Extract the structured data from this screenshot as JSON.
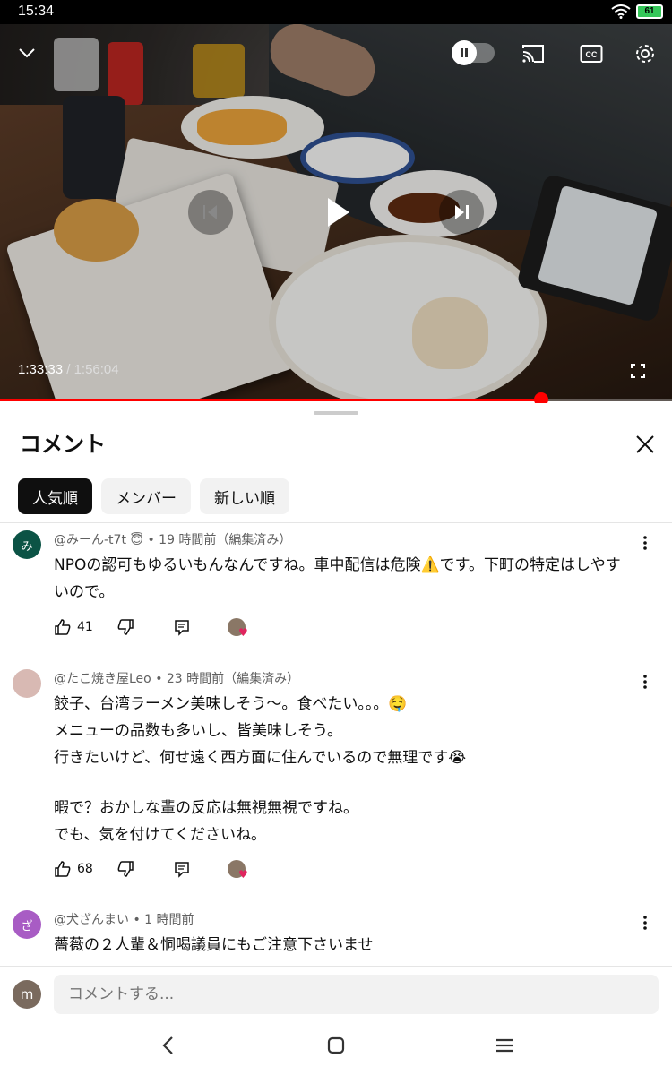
{
  "status_bar": {
    "time": "15:34",
    "battery": "61"
  },
  "video": {
    "current_time": "1:33:33",
    "separator": " / ",
    "duration": "1:56:04",
    "progress_fraction": 0.805,
    "icons": [
      "chevron-down-icon",
      "pause-toggle-icon",
      "cast-icon",
      "captions-icon",
      "settings-icon",
      "previous-icon",
      "play-icon",
      "next-icon",
      "fullscreen-icon"
    ]
  },
  "sheet": {
    "title": "コメント",
    "chips": [
      {
        "label": "人気順",
        "active": true
      },
      {
        "label": "メンバー",
        "active": false
      },
      {
        "label": "新しい順",
        "active": false
      }
    ]
  },
  "comments": [
    {
      "avatar_initial": "み",
      "avatar_color": "#0b5345",
      "author": "@みーん-t7t",
      "badge": "😇",
      "time": "• 19 時間前（編集済み）",
      "lines": [
        "NPOの認可もゆるいもんなんですね。車中配信は危険⚠️です。下町の特定はしやす",
        "いので。"
      ],
      "likes": "41"
    },
    {
      "avatar_initial": "",
      "avatar_color": "#d8b9b3",
      "author": "@たこ焼き屋Leo",
      "badge": "",
      "time": "• 23 時間前（編集済み）",
      "lines": [
        "餃子、台湾ラーメン美味しそう〜。食べたい。。。🤤",
        "メニューの品数も多いし、皆美味しそう。",
        "行きたいけど、何せ遠く西方面に住んでいるので無理です😭",
        "",
        "暇で？おかしな輩の反応は無視無視ですね。",
        "でも、気を付けてくださいね。"
      ],
      "likes": "68"
    },
    {
      "avatar_initial": "ざ",
      "avatar_color": "#a85cc4",
      "author": "@犬ざんまい",
      "badge": "",
      "time": "• 1 時間前",
      "lines": [
        "薔薇の２人輩＆恫喝議員にもご注意下さいませ"
      ],
      "likes": ""
    }
  ],
  "input": {
    "avatar_initial": "m",
    "placeholder": "コメントする..."
  },
  "colors": {
    "accent_red": "#ff0000",
    "chip_active_bg": "#0f0f0f",
    "chip_bg": "#f2f2f2"
  }
}
